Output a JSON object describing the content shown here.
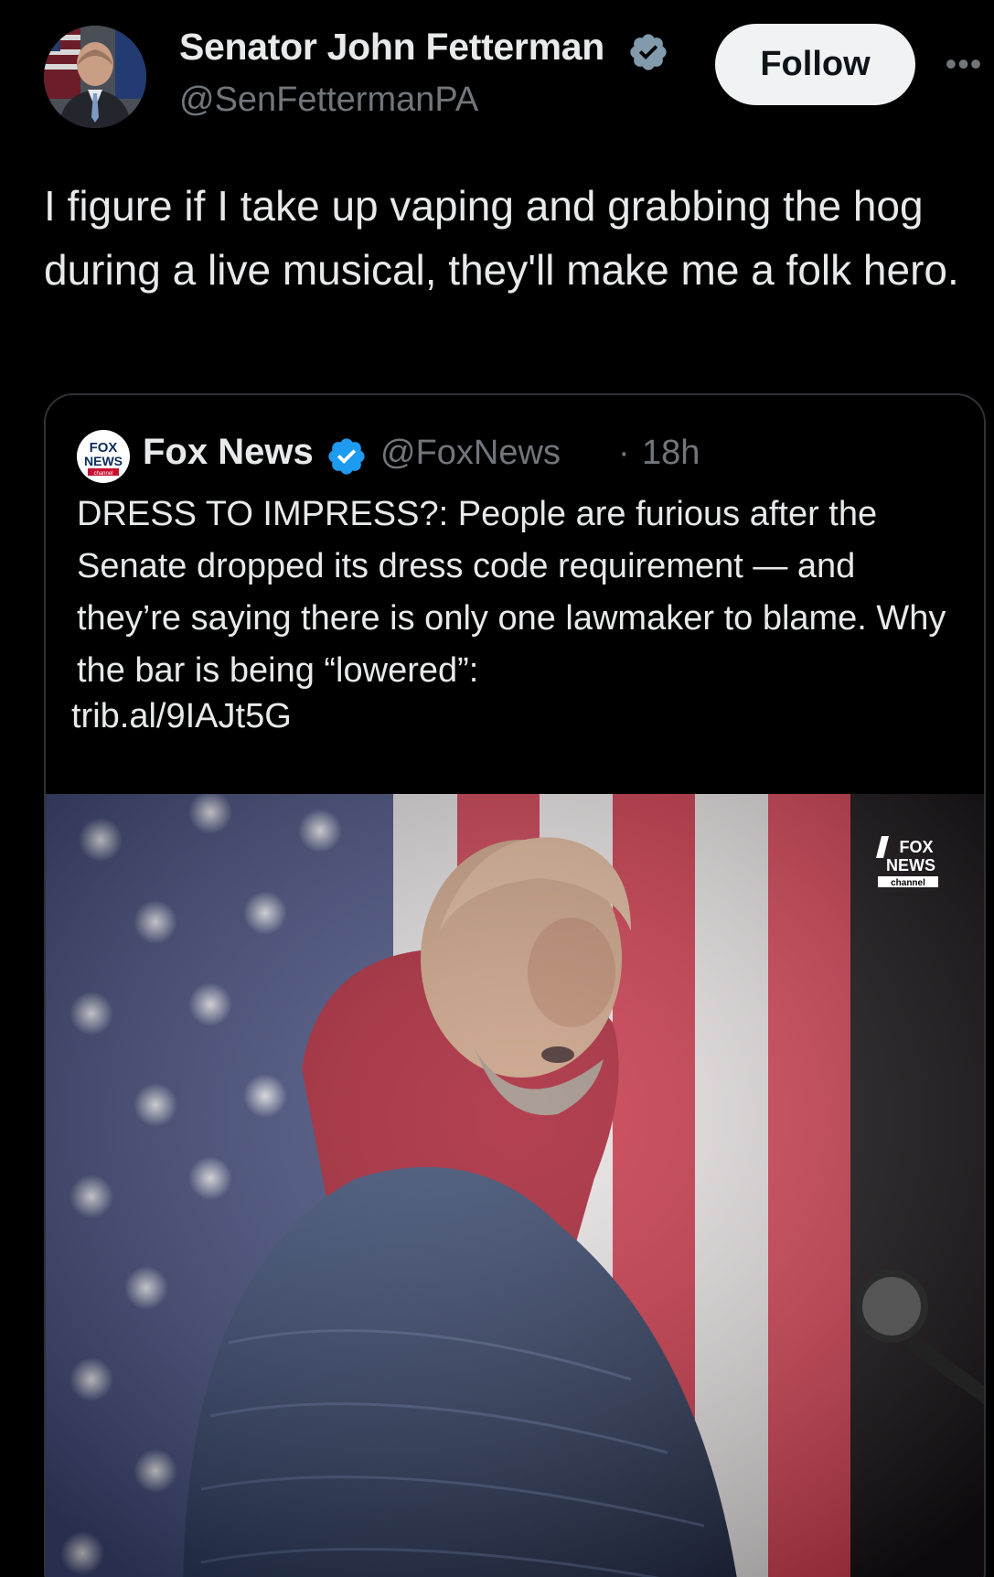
{
  "author": {
    "name": "Senator John Fetterman",
    "handle": "@SenFettermanPA",
    "verified_color": "#829aab"
  },
  "actions": {
    "follow_label": "Follow",
    "more_label": "•••"
  },
  "tweet": {
    "text": "I figure if I take up vaping and grabbing the hog during a live musical, they'll make me a folk hero."
  },
  "quoted": {
    "name": "Fox News",
    "handle": "@FoxNews",
    "separator": "·",
    "time": "18h",
    "verified_color": "#1d9bf0",
    "text": "DRESS TO IMPRESS?: People are furious after the Senate dropped its dress code requirement — and they’re saying there is only one lawmaker to blame. Why the bar is being “lowered”:",
    "link": "trib.al/9IAJt5G",
    "logo_text": [
      "FOX",
      "NEWS",
      "channel"
    ]
  },
  "media": {
    "watermark_text": [
      "FOX",
      "NEWS",
      "channel"
    ]
  },
  "colors": {
    "background": "#000000",
    "text": "#e7e9ea",
    "muted": "#71767b",
    "border": "#2f3336"
  }
}
